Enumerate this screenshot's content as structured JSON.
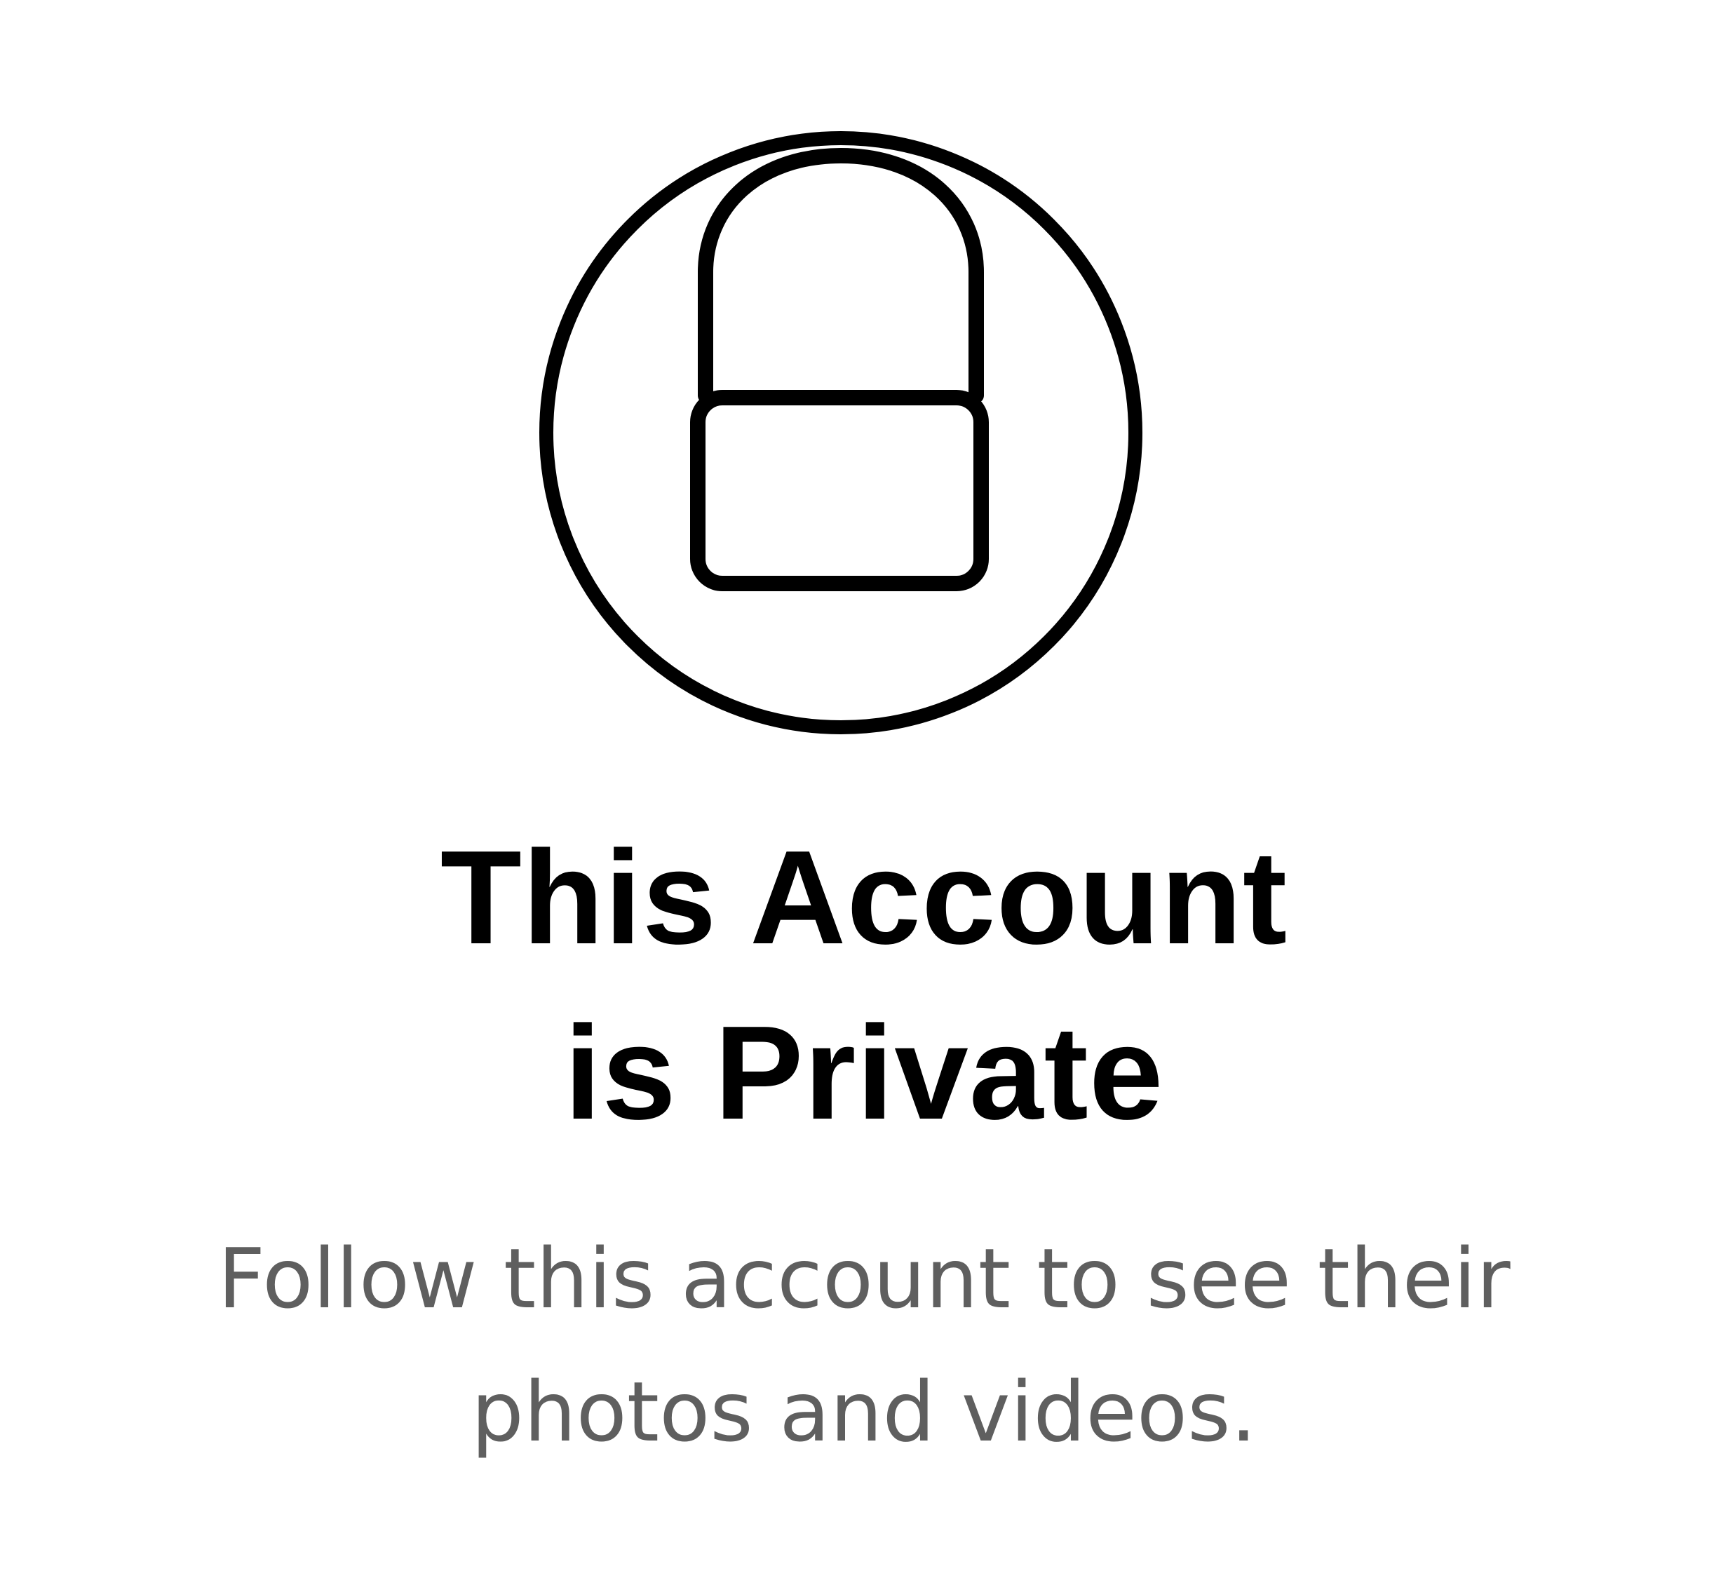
{
  "private_notice": {
    "icon": "lock-icon",
    "title_line1": "This Account",
    "title_line2": "is Private",
    "message_line1": "Follow this account to see their",
    "message_line2": "photos and videos."
  },
  "colors": {
    "background": "#ffffff",
    "icon_stroke": "#000000",
    "title": "#000000",
    "message": "#5f5f5f"
  }
}
